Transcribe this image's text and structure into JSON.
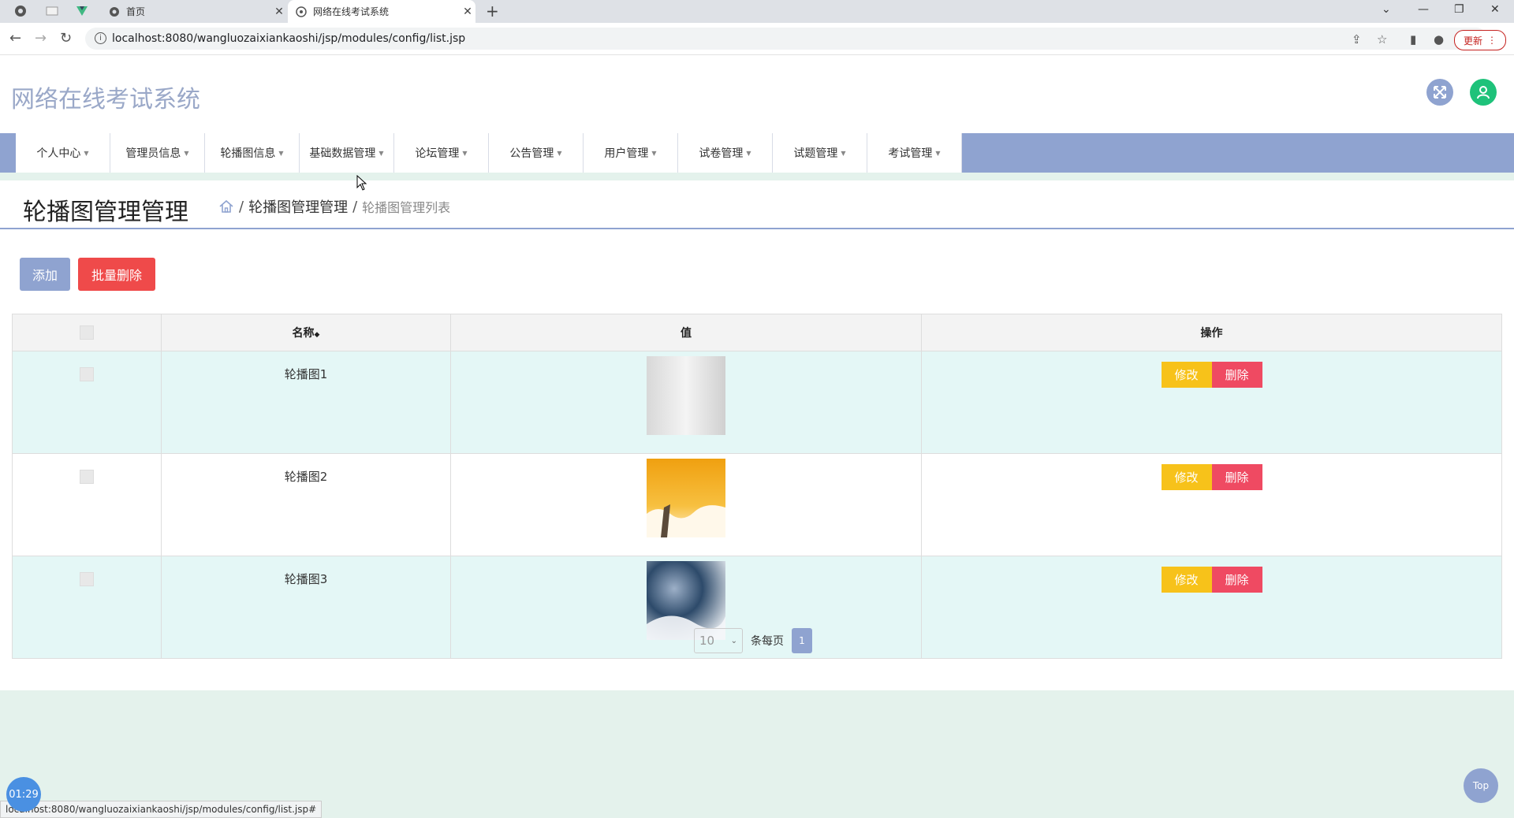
{
  "browser": {
    "tabs": [
      {
        "title": "首页",
        "active": false
      },
      {
        "title": "网络在线考试系统",
        "active": true
      }
    ],
    "url": "localhost:8080/wangluozaixiankaoshi/jsp/modules/config/list.jsp",
    "update_label": "更新",
    "status_url": "localhost:8080/wangluozaixiankaoshi/jsp/modules/config/list.jsp#"
  },
  "app": {
    "title": "网络在线考试系统",
    "accent_color": "#8fa3d0"
  },
  "menu": [
    {
      "label": "个人中心"
    },
    {
      "label": "管理员信息"
    },
    {
      "label": "轮播图信息"
    },
    {
      "label": "基础数据管理"
    },
    {
      "label": "论坛管理"
    },
    {
      "label": "公告管理"
    },
    {
      "label": "用户管理"
    },
    {
      "label": "试卷管理"
    },
    {
      "label": "试题管理"
    },
    {
      "label": "考试管理"
    }
  ],
  "page": {
    "title": "轮播图管理管理",
    "breadcrumb": {
      "sep": "/",
      "level1": "轮播图管理管理",
      "level2": "轮播图管理列表"
    }
  },
  "toolbar": {
    "add_label": "添加",
    "batch_delete_label": "批量删除"
  },
  "table": {
    "headers": {
      "name": "名称",
      "value": "值",
      "ops": "操作"
    },
    "sort_indicator": "◆",
    "rows": [
      {
        "name": "轮播图1",
        "edit_label": "修改",
        "delete_label": "删除"
      },
      {
        "name": "轮播图2",
        "edit_label": "修改",
        "delete_label": "删除"
      },
      {
        "name": "轮播图3",
        "edit_label": "修改",
        "delete_label": "删除"
      }
    ]
  },
  "pagination": {
    "page_size": "10",
    "per_page_label": "条每页",
    "current_page": "1"
  },
  "timer": "01:29",
  "top_label": "Top"
}
